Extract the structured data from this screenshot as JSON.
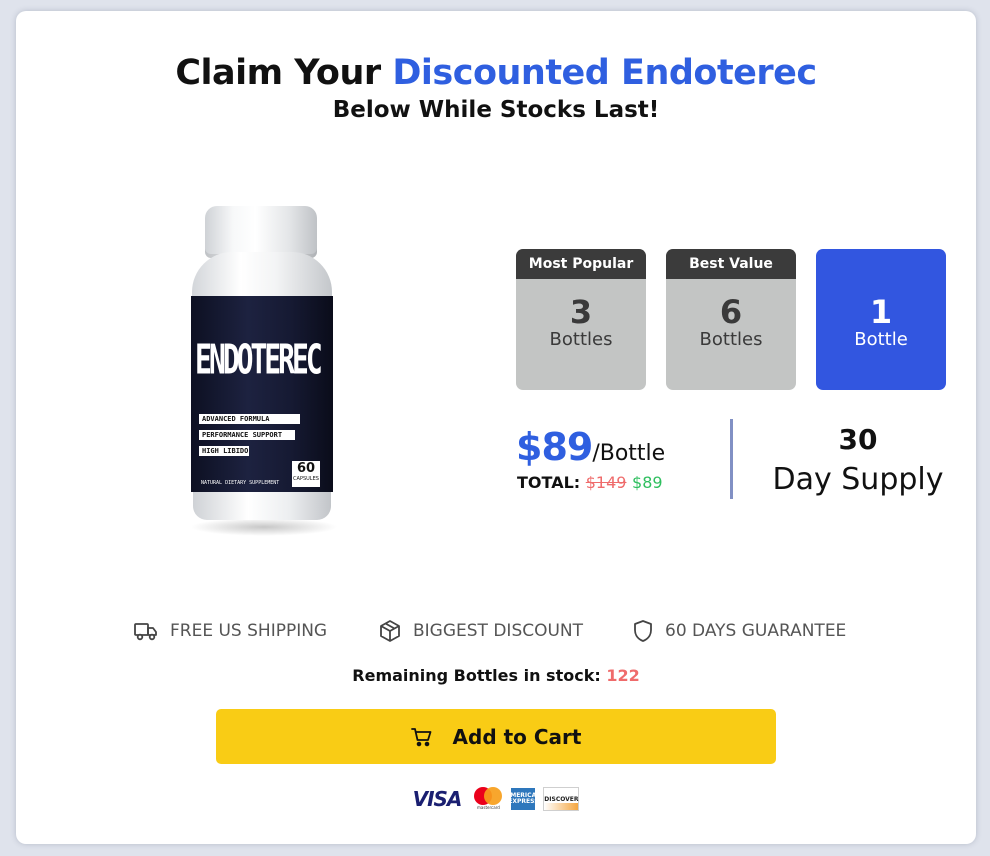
{
  "headline": {
    "prefix": "Claim Your ",
    "accent": "Discounted Endoterec",
    "sub": "Below While Stocks Last!"
  },
  "product": {
    "brand": "ENDOTEREC",
    "tags": [
      "ADVANCED FORMULA",
      "PERFORMANCE SUPPORT",
      "HIGH LIBIDO"
    ],
    "footer": "NATURAL DIETARY SUPPLEMENT",
    "count": "60",
    "count_unit": "CAPSULES"
  },
  "options": [
    {
      "tag": "Most Popular",
      "qty": "3",
      "unit": "Bottles",
      "selected": false
    },
    {
      "tag": "Best Value",
      "qty": "6",
      "unit": "Bottles",
      "selected": false
    },
    {
      "tag": "",
      "qty": "1",
      "unit": "Bottle",
      "selected": true
    }
  ],
  "pricing": {
    "amount": "$89",
    "per": "/Bottle",
    "total_label": "TOTAL:",
    "old_total": "$149",
    "new_total": "$89",
    "supply_days": "30",
    "supply_text": "Day Supply"
  },
  "features": [
    {
      "label": "FREE US SHIPPING",
      "icon": "truck-icon"
    },
    {
      "label": "BIGGEST DISCOUNT",
      "icon": "box-icon"
    },
    {
      "label": "60 DAYS GUARANTEE",
      "icon": "shield-icon"
    }
  ],
  "stock": {
    "label": "Remaining Bottles in stock:",
    "count": "122"
  },
  "cart": {
    "label": "Add to Cart"
  },
  "payments": {
    "visa": "VISA",
    "mastercard": "mastercard",
    "amex": "AMERICAN EXPRESS",
    "discover": "DISCOVER"
  },
  "colors": {
    "accent": "#2f5fe0",
    "selected_option": "#3256e0",
    "option_grey": "#c3c5c4",
    "cart_button": "#f9cc15",
    "old_price": "#ef6b6b",
    "new_price": "#2fbf5f"
  }
}
